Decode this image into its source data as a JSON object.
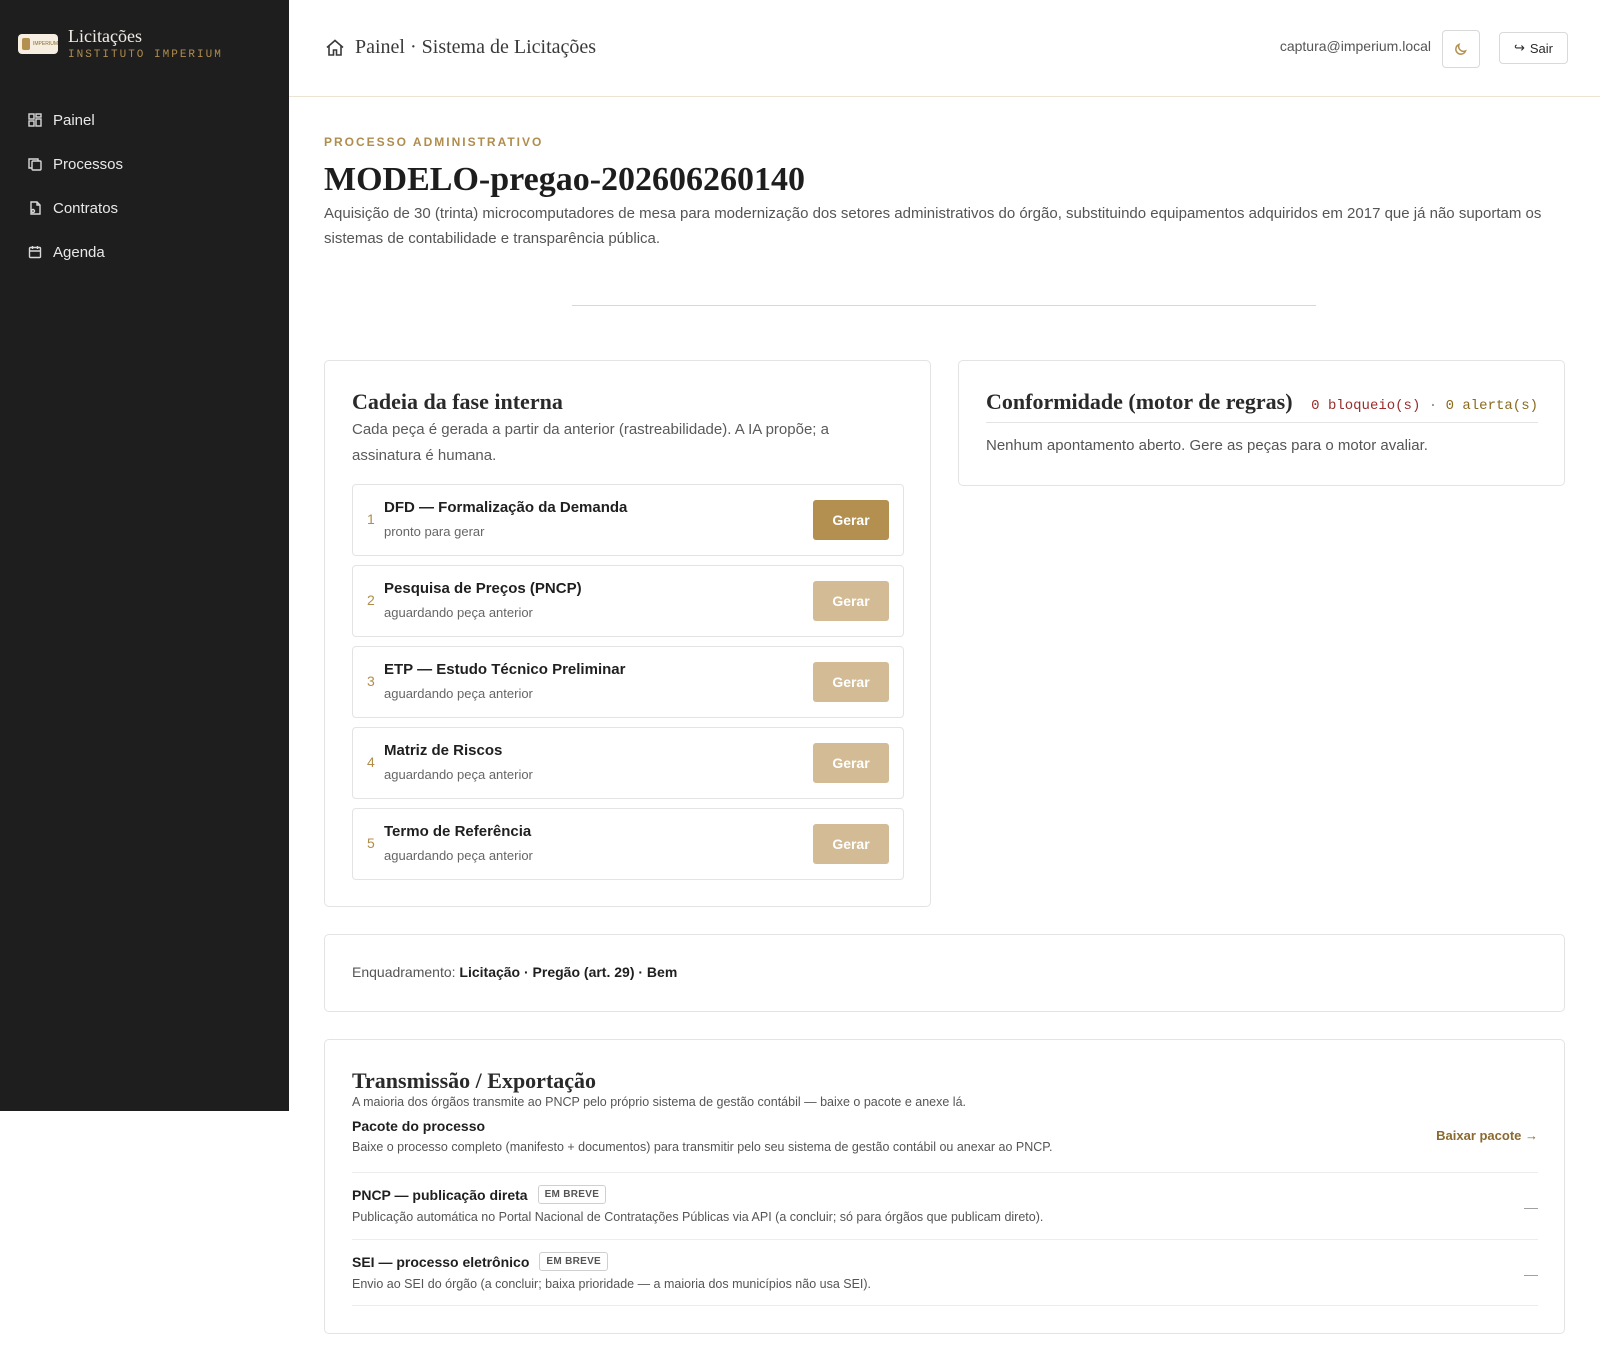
{
  "sidebar": {
    "logo_text": "IMPERIUM",
    "brand_title": "Licitações",
    "brand_subtitle": "INSTITUTO IMPERIUM",
    "items": [
      {
        "label": "Painel",
        "icon": "dashboard-icon"
      },
      {
        "label": "Processos",
        "icon": "copy-icon"
      },
      {
        "label": "Contratos",
        "icon": "contract-icon"
      },
      {
        "label": "Agenda",
        "icon": "calendar-icon"
      }
    ]
  },
  "header": {
    "breadcrumb": "Painel · Sistema de Licitações",
    "user_email": "captura@imperium.local",
    "logout_label": "Sair",
    "logout_icon": "↪"
  },
  "process": {
    "eyebrow": "PROCESSO ADMINISTRATIVO",
    "title": "MODELO-pregao-202606260140",
    "description": "Aquisição de 30 (trinta) microcomputadores de mesa para modernização dos setores administrativos do órgão, substituindo equipamentos adquiridos em 2017 que já não suportam os sistemas de contabilidade e transparência pública."
  },
  "chain": {
    "title": "Cadeia da fase interna",
    "subtitle": "Cada peça é gerada a partir da anterior (rastreabilidade). A IA propõe; a assinatura é humana.",
    "steps": [
      {
        "num": "1",
        "name": "DFD — Formalização da Demanda",
        "status": "pronto para gerar",
        "button": "Gerar"
      },
      {
        "num": "2",
        "name": "Pesquisa de Preços (PNCP)",
        "status": "aguardando peça anterior",
        "button": "Gerar"
      },
      {
        "num": "3",
        "name": "ETP — Estudo Técnico Preliminar",
        "status": "aguardando peça anterior",
        "button": "Gerar"
      },
      {
        "num": "4",
        "name": "Matriz de Riscos",
        "status": "aguardando peça anterior",
        "button": "Gerar"
      },
      {
        "num": "5",
        "name": "Termo de Referência",
        "status": "aguardando peça anterior",
        "button": "Gerar"
      }
    ]
  },
  "conformity": {
    "title": "Conformidade (motor de regras)",
    "blocks": "0 bloqueio(s)",
    "separator": "·",
    "alerts": "0 alerta(s)",
    "empty": "Nenhum apontamento aberto. Gere as peças para o motor avaliar."
  },
  "framing": {
    "label": "Enquadramento:",
    "value": "Licitação · Pregão (art. 29) · Bem"
  },
  "transmission": {
    "title": "Transmissão / Exportação",
    "subtitle": "A maioria dos órgãos transmite ao PNCP pelo próprio sistema de gestão contábil — baixe o pacote e anexe lá.",
    "rows": [
      {
        "name": "Pacote do processo",
        "badge": "",
        "desc": "Baixe o processo completo (manifesto + documentos) para transmitir pelo seu sistema de gestão contábil ou anexar ao PNCP.",
        "action": "Baixar pacote →"
      },
      {
        "name": "PNCP — publicação direta",
        "badge": "EM BREVE",
        "desc": "Publicação automática no Portal Nacional de Contratações Públicas via API (a concluir; só para órgãos que publicam direto).",
        "action": "—"
      },
      {
        "name": "SEI — processo eletrônico",
        "badge": "EM BREVE",
        "desc": "Envio ao SEI do órgão (a concluir; baixa prioridade — a maioria dos municípios não usa SEI).",
        "action": "—"
      }
    ]
  },
  "colors": {
    "accent": "#b3904f",
    "accent_disabled": "#d3bc95",
    "sidebar_bg": "#1e1e1e",
    "block_red": "#9b2c2c"
  }
}
